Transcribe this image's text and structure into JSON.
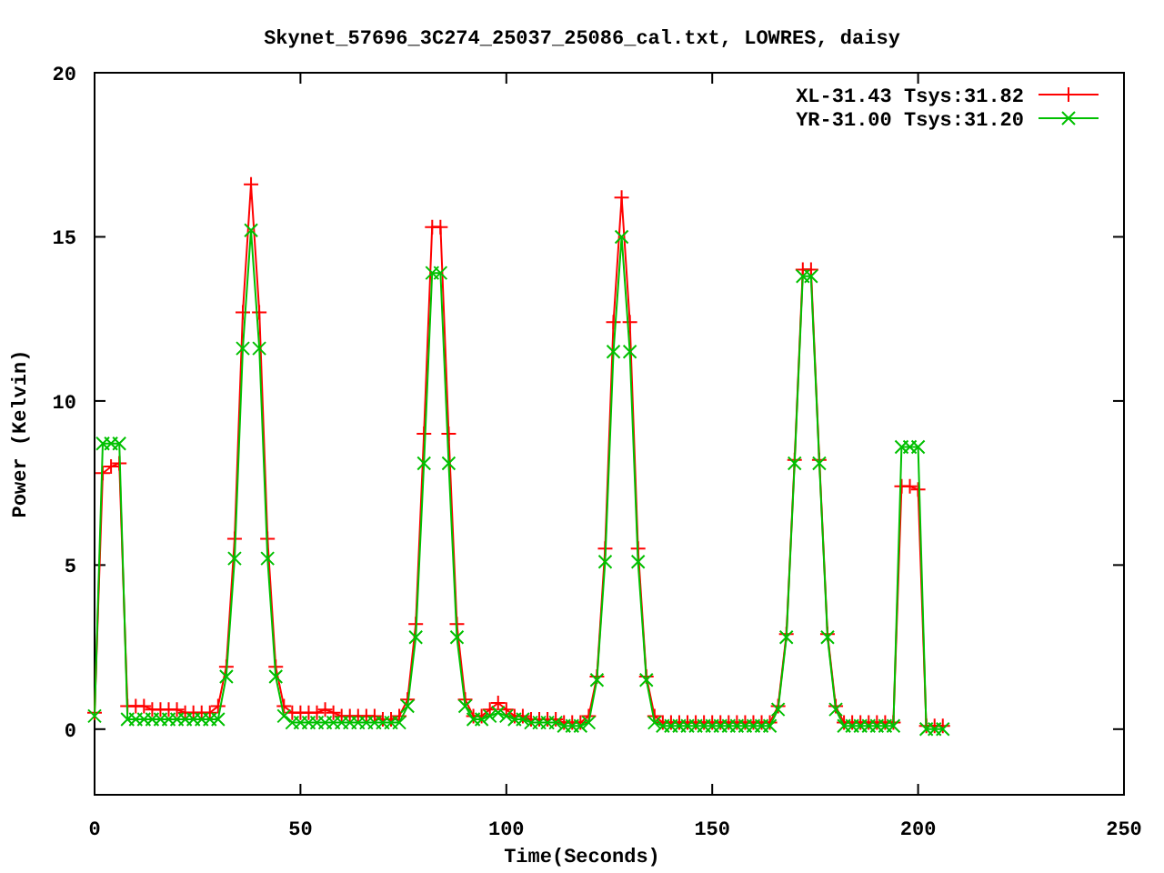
{
  "chart_data": {
    "type": "line",
    "title": "Skynet_57696_3C274_25037_25086_cal.txt, LOWRES, daisy",
    "xlabel": "Time(Seconds)",
    "ylabel": "Power (Kelvin)",
    "xlim": [
      0,
      250
    ],
    "ylim": [
      -2,
      20
    ],
    "xticks": [
      0,
      50,
      100,
      150,
      200,
      250
    ],
    "yticks": [
      0,
      5,
      10,
      15,
      20
    ],
    "legend": true,
    "x": [
      0,
      2,
      4,
      6,
      8,
      10,
      12,
      14,
      16,
      18,
      20,
      22,
      24,
      26,
      28,
      30,
      32,
      34,
      36,
      38,
      40,
      42,
      44,
      46,
      48,
      50,
      52,
      54,
      56,
      58,
      60,
      62,
      64,
      66,
      68,
      70,
      72,
      74,
      76,
      78,
      80,
      82,
      84,
      86,
      88,
      90,
      92,
      94,
      96,
      98,
      100,
      102,
      104,
      106,
      108,
      110,
      112,
      114,
      116,
      118,
      120,
      122,
      124,
      126,
      128,
      130,
      132,
      134,
      136,
      138,
      140,
      142,
      144,
      146,
      148,
      150,
      152,
      154,
      156,
      158,
      160,
      162,
      164,
      166,
      168,
      170,
      172,
      174,
      176,
      178,
      180,
      182,
      184,
      186,
      188,
      190,
      192,
      194,
      196,
      198,
      200,
      202,
      204,
      206
    ],
    "series": [
      {
        "name": "XL-31.43 Tsys:31.82",
        "color": "#ff0000",
        "marker": "plus",
        "values": [
          0.5,
          7.8,
          8.0,
          8.1,
          0.7,
          0.7,
          0.7,
          0.6,
          0.6,
          0.6,
          0.6,
          0.5,
          0.5,
          0.5,
          0.5,
          0.7,
          1.9,
          5.8,
          12.7,
          16.6,
          12.7,
          5.8,
          1.9,
          0.7,
          0.5,
          0.5,
          0.5,
          0.5,
          0.6,
          0.5,
          0.4,
          0.4,
          0.4,
          0.4,
          0.4,
          0.3,
          0.3,
          0.4,
          0.9,
          3.2,
          9.0,
          15.3,
          15.3,
          9.0,
          3.2,
          0.9,
          0.4,
          0.4,
          0.6,
          0.8,
          0.6,
          0.4,
          0.4,
          0.3,
          0.3,
          0.3,
          0.3,
          0.2,
          0.2,
          0.2,
          0.4,
          1.6,
          5.5,
          12.4,
          16.2,
          12.4,
          5.5,
          1.6,
          0.4,
          0.2,
          0.2,
          0.2,
          0.2,
          0.2,
          0.2,
          0.2,
          0.2,
          0.2,
          0.2,
          0.2,
          0.2,
          0.2,
          0.2,
          0.7,
          2.9,
          8.2,
          14.0,
          14.0,
          8.2,
          2.9,
          0.7,
          0.2,
          0.2,
          0.2,
          0.2,
          0.2,
          0.2,
          0.2,
          7.4,
          7.4,
          7.3,
          0.1,
          0.1,
          0.1
        ]
      },
      {
        "name": "YR-31.00 Tsys:31.20",
        "color": "#00c000",
        "marker": "cross",
        "values": [
          0.4,
          8.7,
          8.7,
          8.7,
          0.3,
          0.3,
          0.3,
          0.3,
          0.3,
          0.3,
          0.3,
          0.3,
          0.3,
          0.3,
          0.3,
          0.3,
          1.6,
          5.2,
          11.6,
          15.2,
          11.6,
          5.2,
          1.6,
          0.4,
          0.2,
          0.2,
          0.2,
          0.2,
          0.2,
          0.2,
          0.2,
          0.2,
          0.2,
          0.2,
          0.2,
          0.2,
          0.2,
          0.2,
          0.7,
          2.8,
          8.1,
          13.9,
          13.9,
          8.1,
          2.8,
          0.7,
          0.3,
          0.3,
          0.4,
          0.5,
          0.4,
          0.3,
          0.3,
          0.2,
          0.2,
          0.2,
          0.2,
          0.1,
          0.1,
          0.1,
          0.2,
          1.5,
          5.1,
          11.5,
          15.0,
          11.5,
          5.1,
          1.5,
          0.2,
          0.1,
          0.1,
          0.1,
          0.1,
          0.1,
          0.1,
          0.1,
          0.1,
          0.1,
          0.1,
          0.1,
          0.1,
          0.1,
          0.1,
          0.6,
          2.8,
          8.1,
          13.8,
          13.8,
          8.1,
          2.8,
          0.6,
          0.1,
          0.1,
          0.1,
          0.1,
          0.1,
          0.1,
          0.1,
          8.6,
          8.6,
          8.6,
          0.0,
          0.0,
          0.0
        ]
      }
    ]
  }
}
